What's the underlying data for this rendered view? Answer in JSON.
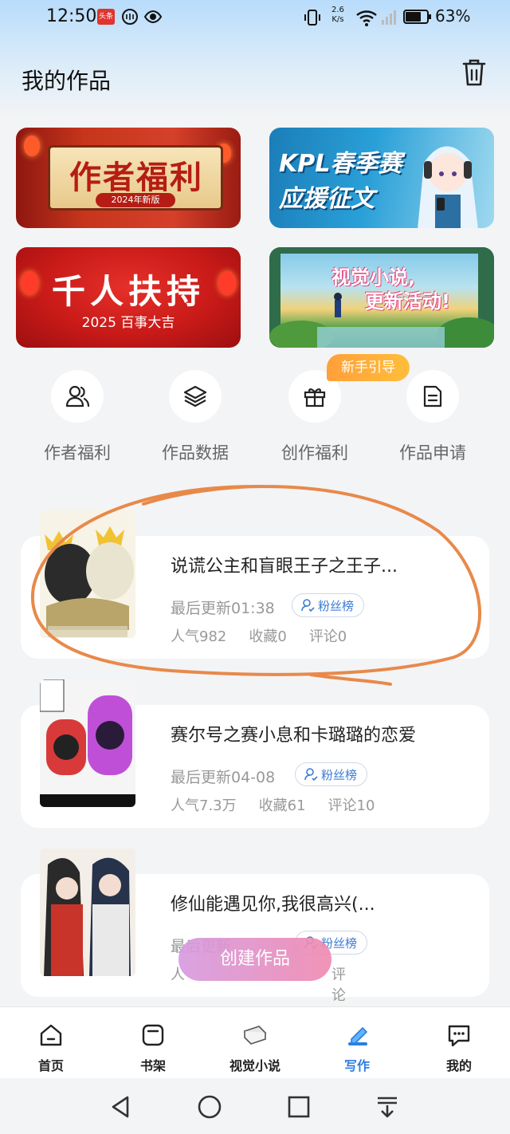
{
  "status_bar": {
    "time": "12:50",
    "badge": "头条",
    "net_speed_value": "2.6",
    "net_speed_unit": "K/s",
    "battery": "63%"
  },
  "header": {
    "title": "我的作品"
  },
  "banners": [
    {
      "title": "作者福利",
      "subtitle": "2024年新版"
    },
    {
      "line1": "KPL春季赛",
      "line2": "应援征文"
    },
    {
      "title": "千人扶持",
      "subtitle": "2025 百事大吉"
    },
    {
      "line1": "视觉小说,",
      "line2": "更新活动!"
    }
  ],
  "quick_entries": [
    {
      "label": "作者福利",
      "icon": "users-icon"
    },
    {
      "label": "作品数据",
      "icon": "layers-icon"
    },
    {
      "label": "创作福利",
      "icon": "gift-icon"
    },
    {
      "label": "作品申请",
      "icon": "document-icon"
    }
  ],
  "newbie_tag": "新手引导",
  "works": [
    {
      "title": "说谎公主和盲眼王子之王子...",
      "last_update": "最后更新01:38",
      "fans_label": "粉丝榜",
      "popularity": "人气982",
      "favorites": "收藏0",
      "comments": "评论0"
    },
    {
      "title": "赛尔号之赛小息和卡璐璐的恋爱",
      "last_update": "最后更新04-08",
      "fans_label": "粉丝榜",
      "popularity": "人气7.3万",
      "favorites": "收藏61",
      "comments": "评论10"
    },
    {
      "title": "修仙能遇见你,我很高兴(...",
      "last_update": "最后更新",
      "fans_label": "粉丝榜",
      "popularity": "人",
      "favorites": "",
      "comments": "评论0"
    }
  ],
  "create_button": "创建作品",
  "bottom_nav": [
    {
      "label": "首页",
      "icon": "home-icon",
      "active": false
    },
    {
      "label": "书架",
      "icon": "bookshelf-icon",
      "active": false
    },
    {
      "label": "视觉小说",
      "icon": "book-icon",
      "active": false
    },
    {
      "label": "写作",
      "icon": "pen-icon",
      "active": true
    },
    {
      "label": "我的",
      "icon": "chat-icon",
      "active": false
    }
  ],
  "colors": {
    "accent": "#2d7de0",
    "highlight_stroke": "#e8894a",
    "newbie_tag": "#ffae3b"
  }
}
